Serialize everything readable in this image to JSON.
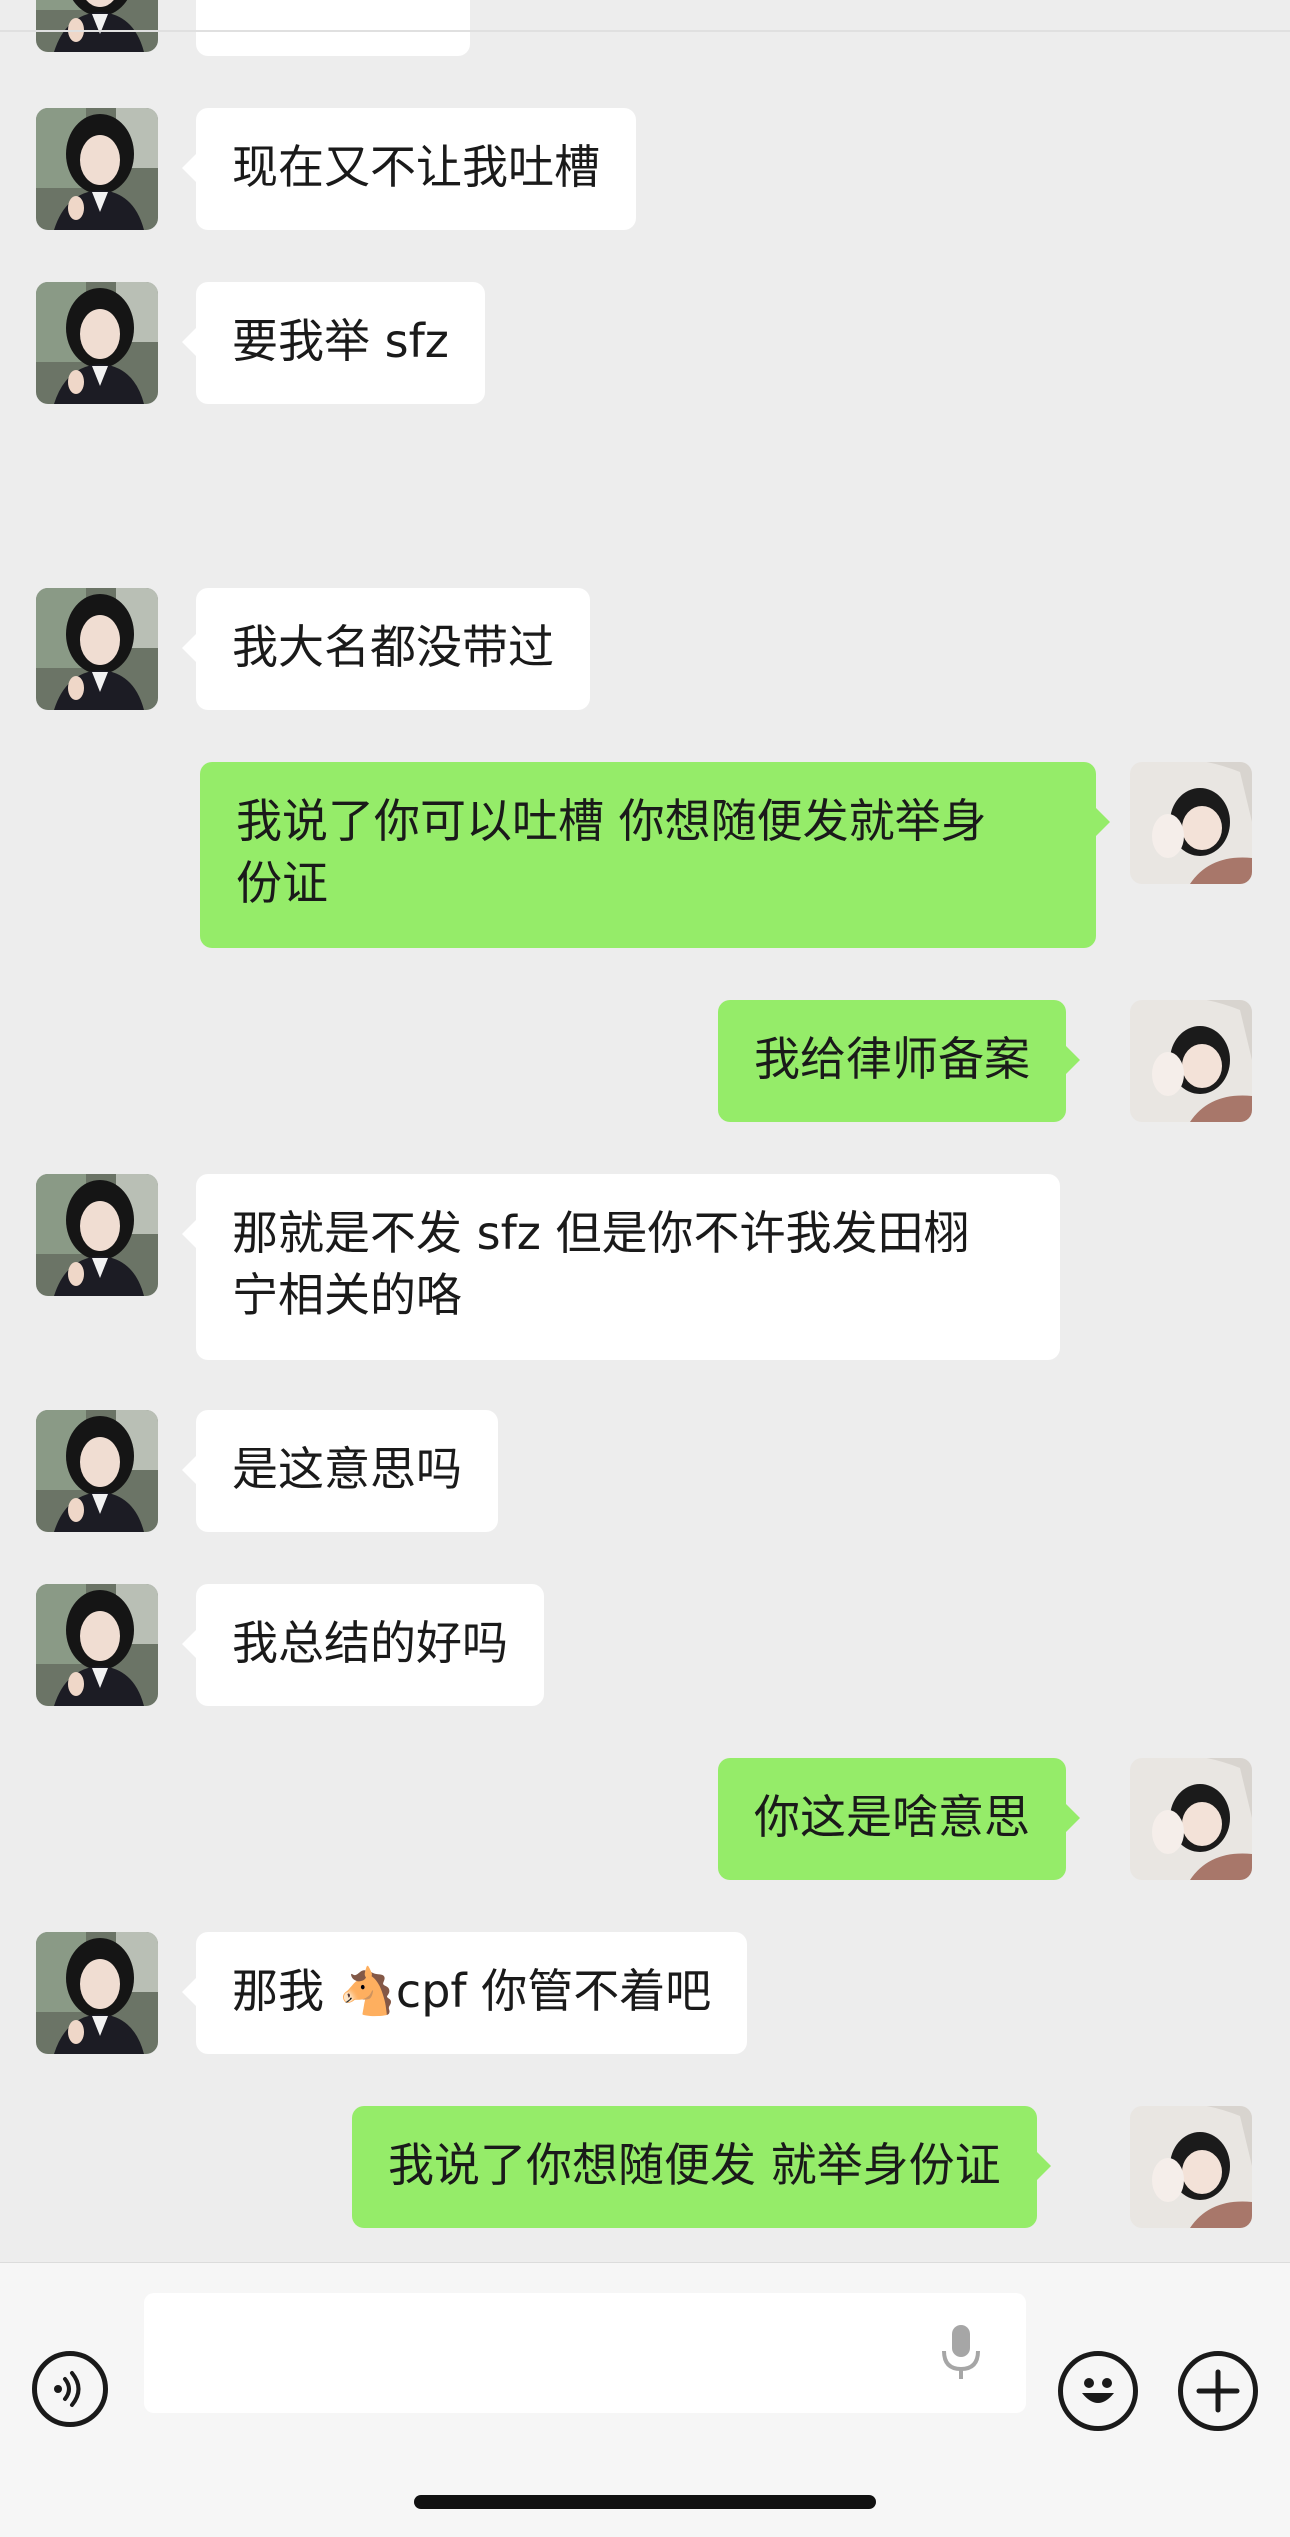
{
  "chat": {
    "timestamp": "",
    "messages": [
      {
        "side": "left",
        "text": "现在又不让我吐槽"
      },
      {
        "side": "left",
        "text": "要我举 sfz"
      },
      {
        "side": "left",
        "text": "我大名都没带过"
      },
      {
        "side": "right",
        "text": "我说了你可以吐槽 你想随便发就举身\n份证"
      },
      {
        "side": "right",
        "text": "我给律师备案"
      },
      {
        "side": "left",
        "text": "那就是不发 sfz 但是你不许我发田栩\n宁相关的咯"
      },
      {
        "side": "left",
        "text": "是这意思吗"
      },
      {
        "side": "left",
        "text": "我总结的好吗"
      },
      {
        "side": "right",
        "text": "你这是啥意思"
      },
      {
        "side": "left",
        "text": "那我 🐴cpf 你管不着吧"
      },
      {
        "side": "right",
        "text": "我说了你想随便发 就举身份证"
      }
    ]
  },
  "input": {
    "voice_icon": "voice-icon",
    "mic_icon": "microphone-icon",
    "emoji_icon": "emoji-icon",
    "plus_icon": "plus-icon"
  },
  "colors": {
    "background": "#ededed",
    "incoming_bubble": "#ffffff",
    "outgoing_bubble": "#95ec69"
  }
}
